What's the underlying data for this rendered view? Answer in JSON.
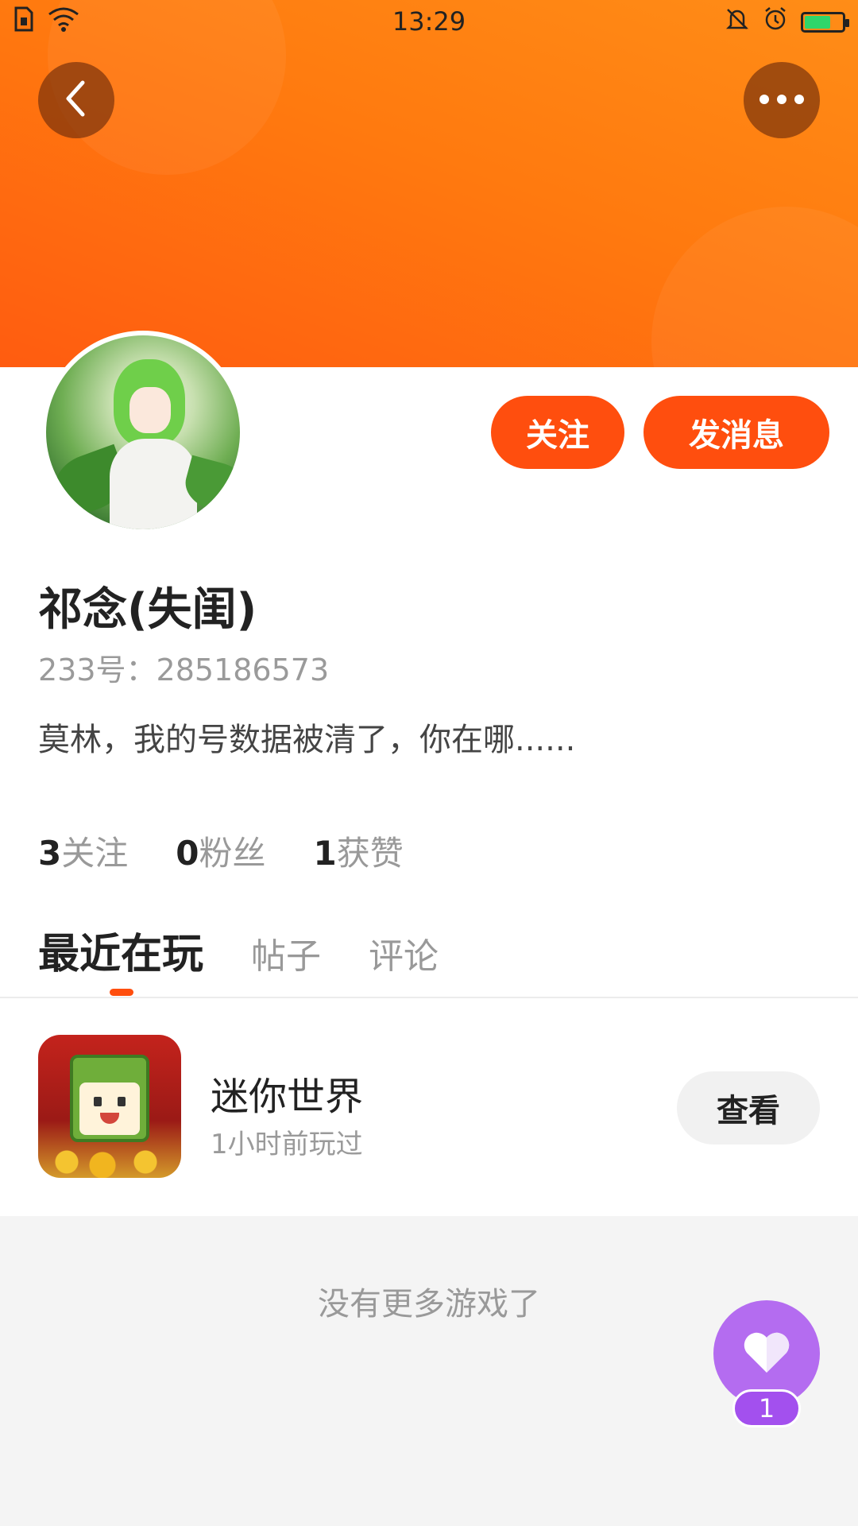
{
  "status_bar": {
    "time": "13:29"
  },
  "profile": {
    "name": "祁念(失闺)",
    "id_line": "233号：285186573",
    "bio": "莫林，我的号数据被清了，你在哪......",
    "follow_label": "关注",
    "message_label": "发消息",
    "stats": [
      {
        "num": "3",
        "label": "关注"
      },
      {
        "num": "0",
        "label": "粉丝"
      },
      {
        "num": "1",
        "label": "获赞"
      }
    ]
  },
  "tabs": [
    {
      "label": "最近在玩",
      "active": true
    },
    {
      "label": "帖子",
      "active": false
    },
    {
      "label": "评论",
      "active": false
    }
  ],
  "games": [
    {
      "name": "迷你世界",
      "played": "1小时前玩过",
      "action_label": "查看",
      "icon": "mini-world-icon"
    }
  ],
  "footer": {
    "no_more": "没有更多游戏了"
  },
  "like": {
    "count": "1",
    "icon": "heart-icon"
  },
  "colors": {
    "accent": "#ff4e0e",
    "header_orange": "#ff7a0f",
    "like_purple": "#b46cf0"
  }
}
